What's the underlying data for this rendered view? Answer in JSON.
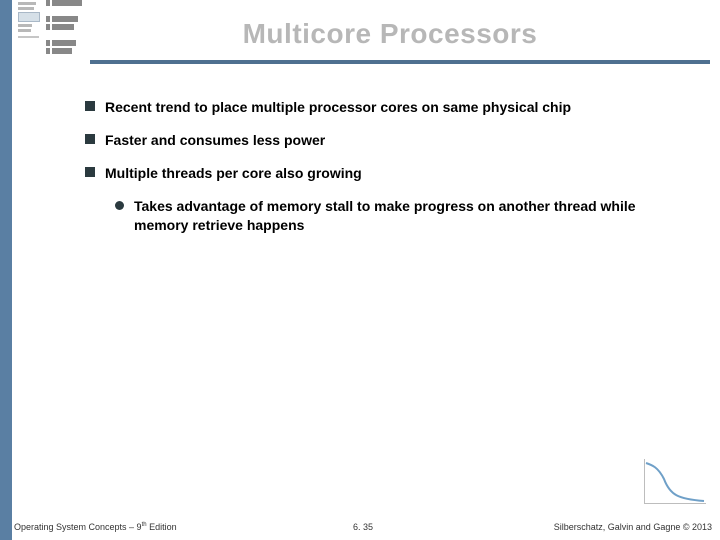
{
  "header": {
    "title": "Multicore Processors"
  },
  "bullets": [
    {
      "text": "Recent trend to place multiple processor cores on same physical chip"
    },
    {
      "text": "Faster and consumes less power"
    },
    {
      "text": "Multiple threads per core also growing",
      "children": [
        {
          "text": "Takes advantage of memory stall to make progress on another thread while memory retrieve happens"
        }
      ]
    }
  ],
  "footer": {
    "left_pre": "Operating System Concepts – 9",
    "left_sup": "th",
    "left_post": " Edition",
    "center": "6. 35",
    "right": "Silberschatz, Galvin and Gagne © 2013"
  },
  "colors": {
    "rule": "#4f7090",
    "left_col": "#5a7fa3",
    "title": "#b7b7b7"
  }
}
